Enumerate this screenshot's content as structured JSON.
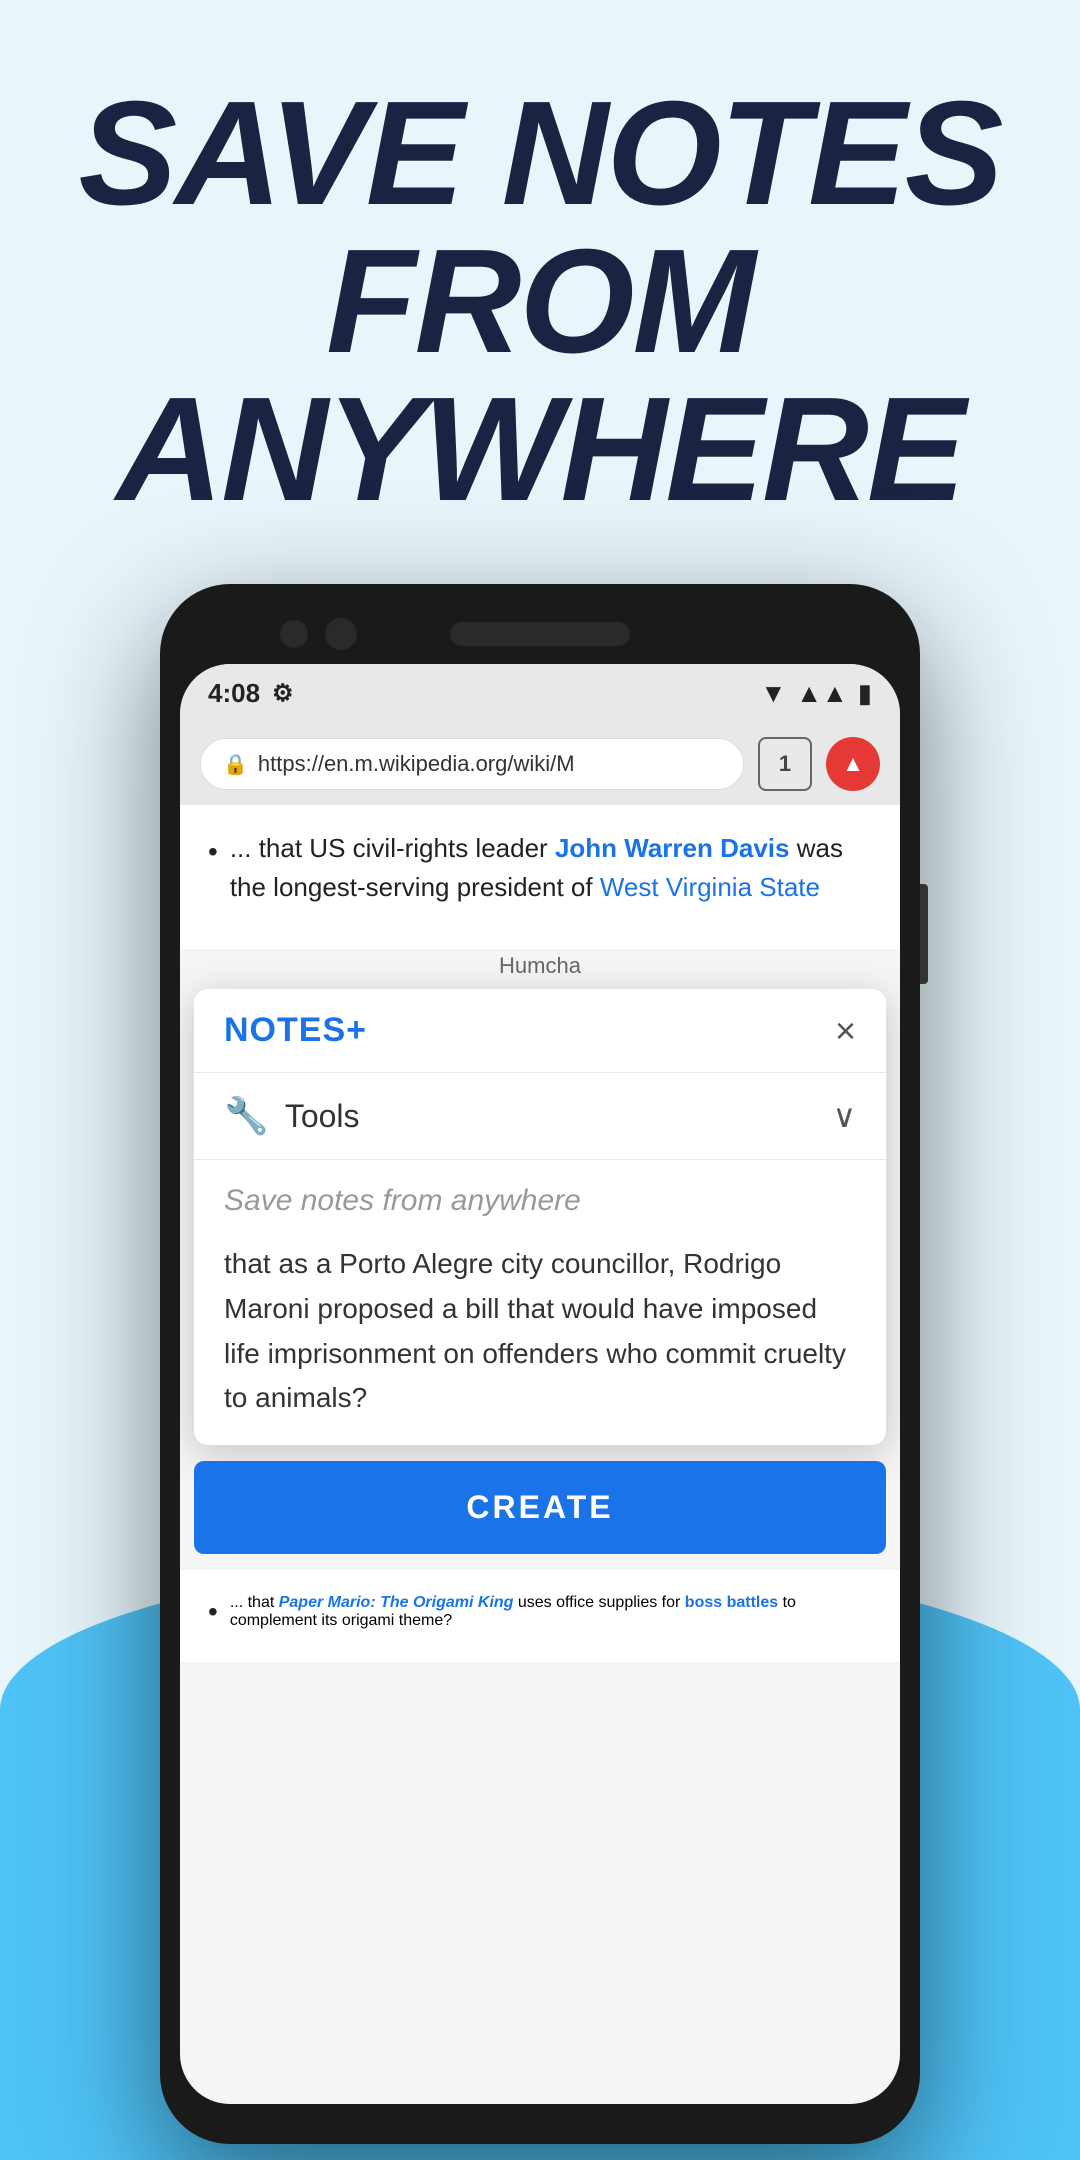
{
  "headline": {
    "line1": "SAVE NOTES",
    "line2": "FROM ANYWHERE"
  },
  "phone": {
    "status_bar": {
      "time": "4:08",
      "settings_icon": "gear",
      "wifi_icon": "wifi",
      "signal_icon": "signal",
      "battery_icon": "battery"
    },
    "browser": {
      "url": "https://en.m.wikipedia.org/wiki/M",
      "tab_count": "1",
      "lock_icon": "lock"
    },
    "tooltip": "Humcha",
    "wiki_items": [
      {
        "text_before": "... that US civil-rights leader ",
        "link_text": "John Warren Davis",
        "text_after": " was the longest-serving president of ",
        "link_text2": "West Virginia State"
      }
    ],
    "notes_popup": {
      "title": "NOTES+",
      "close_label": "×",
      "tools_label": "Tools",
      "tools_icon": "wrench",
      "chevron_icon": "chevron-down",
      "placeholder_text": "Save notes from anywhere",
      "body_text": "that as a Porto Alegre city councillor, Rodrigo Maroni proposed a bill that would have imposed life imprisonment on offenders who commit cruelty to animals?",
      "create_button_label": "CREATE"
    },
    "bottom_wiki": {
      "text_before": "... that ",
      "link_italic": "Paper Mario: The Origami King",
      "text_middle": " uses office supplies for ",
      "link_text": "boss battles",
      "text_after": " to complement its origami theme?"
    }
  }
}
